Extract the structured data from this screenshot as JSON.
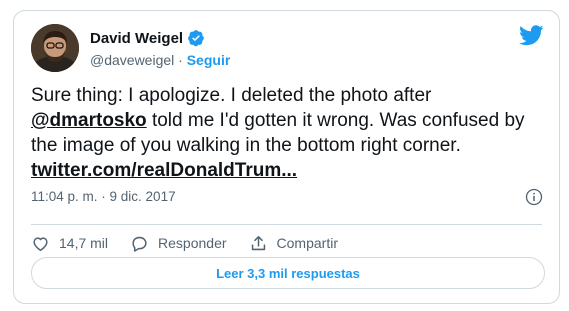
{
  "author": {
    "name": "David Weigel",
    "handle": "@daveweigel",
    "separator": "·",
    "follow_label": "Seguir"
  },
  "tweet": {
    "text_part1": "Sure thing: I apologize. I deleted the photo after ",
    "mention": "@dmartosko",
    "text_part2": " told me I'd gotten it wrong. Was confused by the image of you walking in the bottom right corner. ",
    "link": "twitter.com/realDonaldTrum..."
  },
  "meta": {
    "timestamp": "11:04 p. m. · 9 dic. 2017"
  },
  "actions": {
    "likes_count": "14,7 mil",
    "reply_label": "Responder",
    "share_label": "Compartir"
  },
  "replies_button_label": "Leer 3,3 mil respuestas",
  "colors": {
    "accent": "#1d9bf0",
    "text_primary": "#0f1419",
    "text_secondary": "#536471",
    "border": "#cfd9de"
  },
  "icons": [
    "verified-badge-icon",
    "twitter-bird-icon",
    "info-icon",
    "heart-icon",
    "reply-bubble-icon",
    "share-icon"
  ]
}
